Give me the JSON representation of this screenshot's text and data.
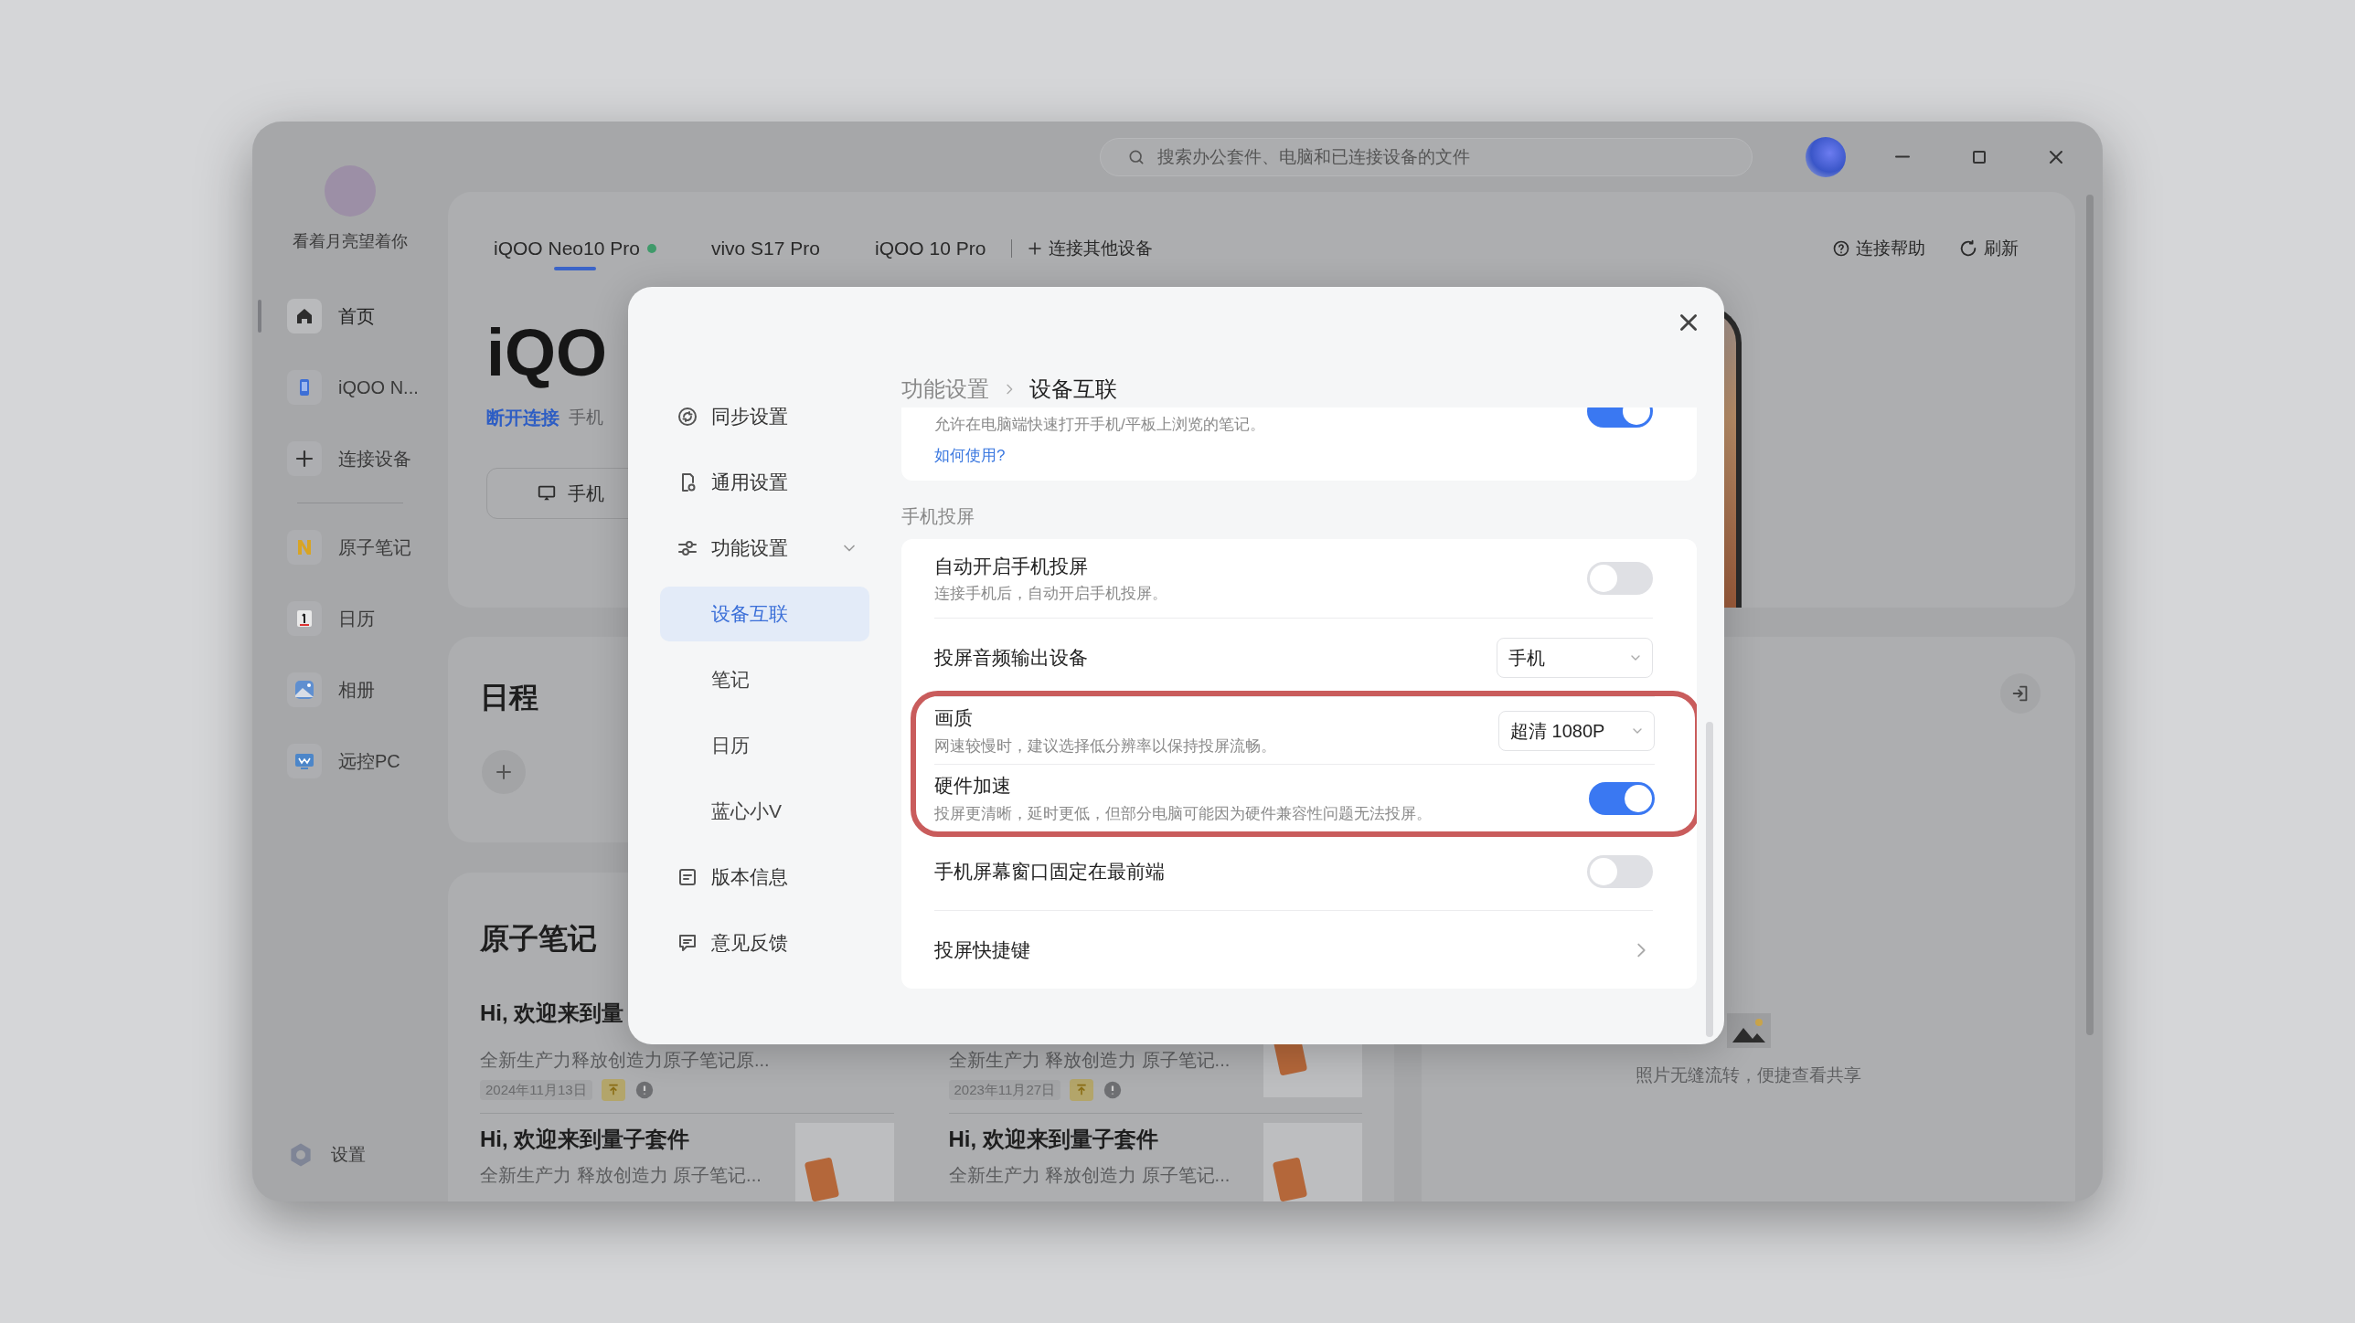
{
  "search": {
    "placeholder": "搜索办公套件、电脑和已连接设备的文件"
  },
  "user": {
    "name": "看着月亮望着你"
  },
  "sidebar": {
    "items": [
      {
        "label": "首页",
        "kind": "home",
        "selected": true
      },
      {
        "label": "iQOO N...",
        "kind": "phone",
        "selected": false
      },
      {
        "label": "连接设备",
        "kind": "add",
        "selected": false
      },
      {
        "label": "原子笔记",
        "kind": "notes",
        "selected": false
      },
      {
        "label": "日历",
        "kind": "calendar",
        "selected": false
      },
      {
        "label": "相册",
        "kind": "photos",
        "selected": false
      },
      {
        "label": "远控PC",
        "kind": "remote",
        "selected": false
      }
    ],
    "settings": "设置"
  },
  "device_tabs": [
    {
      "label": "iQOO Neo10 Pro",
      "selected": true,
      "connected": true
    },
    {
      "label": "vivo S17 Pro",
      "selected": false,
      "connected": false
    },
    {
      "label": "iQOO 10 Pro",
      "selected": false,
      "connected": false
    }
  ],
  "connect_other": "连接其他设备",
  "help": "连接帮助",
  "refresh": "刷新",
  "device": {
    "name": "iQO",
    "disconnect": "断开连接",
    "status": "手机",
    "cast_button": "手机"
  },
  "schedule": {
    "title": "日程"
  },
  "notes": {
    "title": "原子笔记",
    "items": [
      {
        "title": "Hi, 欢迎来到量",
        "snippet": "全新生产力释放创造力原子笔记原...",
        "date": "2024年11月13日",
        "thumbnail": false
      },
      {
        "snippet": "全新生产力 释放创造力 原子笔记...",
        "date": "2023年11月27日",
        "thumbnail": true
      },
      {
        "title": "Hi, 欢迎来到量子套件",
        "snippet": "全新生产力 释放创造力 原子笔记...",
        "thumbnail": true
      },
      {
        "title": "Hi, 欢迎来到量子套件",
        "snippet": "全新生产力 释放创造力 原子笔记...",
        "thumbnail": true
      }
    ]
  },
  "photos": {
    "caption": "照片无缝流转，便捷查看共享"
  },
  "dialog": {
    "nav": [
      {
        "label": "同步设置",
        "kind": "sync",
        "selected": false
      },
      {
        "label": "通用设置",
        "kind": "general",
        "selected": false
      },
      {
        "label": "功能设置",
        "kind": "features",
        "selected": false,
        "expanded": true,
        "children": [
          {
            "label": "设备互联",
            "selected": true
          },
          {
            "label": "笔记",
            "selected": false
          },
          {
            "label": "日历",
            "selected": false
          },
          {
            "label": "蓝心小V",
            "selected": false
          }
        ]
      },
      {
        "label": "版本信息",
        "kind": "version",
        "selected": false
      },
      {
        "label": "意见反馈",
        "kind": "feedback",
        "selected": false
      }
    ],
    "breadcrumb": [
      "功能设置",
      "设备互联"
    ],
    "top_card": {
      "description": "允许在电脑端快速打开手机/平板上浏览的笔记。",
      "link": "如何使用?",
      "on": true
    },
    "section": {
      "title": "手机投屏",
      "rows": [
        {
          "kind": "toggle",
          "title": "自动开启手机投屏",
          "description": "连接手机后，自动开启手机投屏。",
          "on": false,
          "highlighted": false
        },
        {
          "kind": "select",
          "title": "投屏音频输出设备",
          "value": "手机",
          "highlighted": false
        },
        {
          "kind": "select",
          "title": "画质",
          "description": "网速较慢时，建议选择低分辨率以保持投屏流畅。",
          "value": "超清 1080P",
          "highlighted": true
        },
        {
          "kind": "toggle",
          "title": "硬件加速",
          "description": "投屏更清晰，延时更低，但部分电脑可能因为硬件兼容性问题无法投屏。",
          "on": true,
          "highlighted": true
        },
        {
          "kind": "toggle",
          "title": "手机屏幕窗口固定在最前端",
          "on": false,
          "highlighted": false
        },
        {
          "kind": "link",
          "title": "投屏快捷键",
          "highlighted": false
        }
      ]
    }
  }
}
